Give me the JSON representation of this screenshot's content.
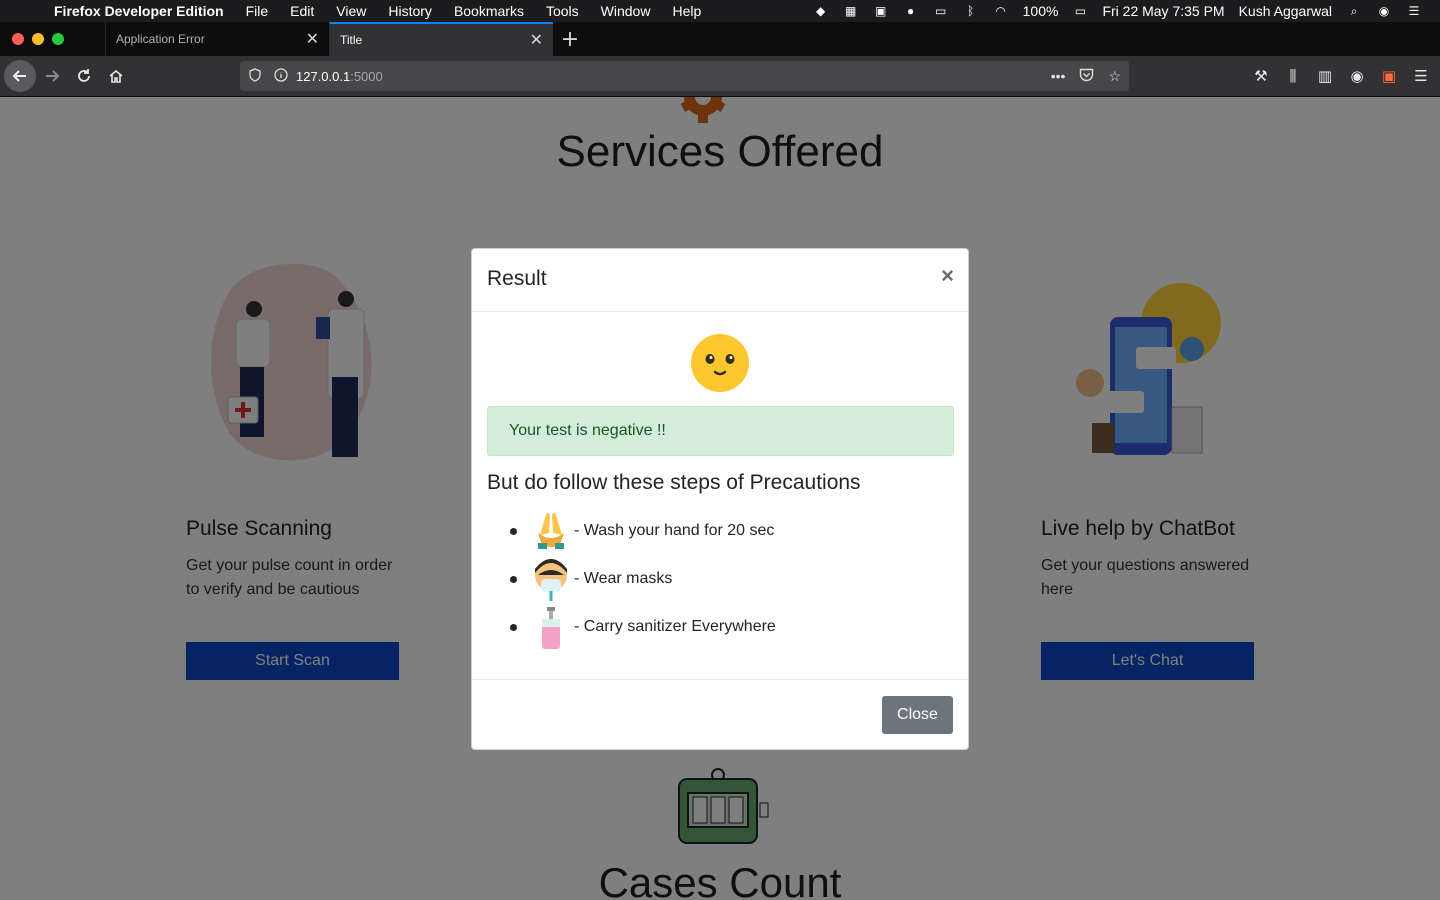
{
  "menubar": {
    "app_name": "Firefox Developer Edition",
    "items": [
      "File",
      "Edit",
      "View",
      "History",
      "Bookmarks",
      "Tools",
      "Window",
      "Help"
    ],
    "battery": "100%",
    "datetime": "Fri 22 May  7:35 PM",
    "user": "Kush Aggarwal"
  },
  "tabs": [
    {
      "label": "Application Error"
    },
    {
      "label": "Title"
    }
  ],
  "urlbar": {
    "host": "127.0.0.1",
    "port": ":5000"
  },
  "page": {
    "services_title": "Services Offered",
    "cases_title": "Cases Count",
    "cards": [
      {
        "heading": "Pulse Scanning",
        "text": "Get your pulse count in order to verify and be cautious",
        "button": "Start Scan"
      },
      {
        "heading": "Live help by ChatBot",
        "text": "Get your questions answered here",
        "button": "Let's Chat"
      }
    ]
  },
  "modal": {
    "title": "Result",
    "close_x": "×",
    "alert": "Your test is negative !!",
    "precautions_heading": "But do follow these steps of Precautions",
    "precautions": [
      {
        "icon": "hand-wash-icon",
        "text": "- Wash your hand for 20 sec"
      },
      {
        "icon": "mask-icon",
        "text": "- Wear masks"
      },
      {
        "icon": "sanitizer-icon",
        "text": "- Carry sanitizer Everywhere"
      }
    ],
    "close_button": "Close"
  },
  "colors": {
    "primary_button": "#0d47c7",
    "alert_bg": "#d4edda",
    "alert_text": "#155724",
    "secondary_button": "#6c757d"
  }
}
